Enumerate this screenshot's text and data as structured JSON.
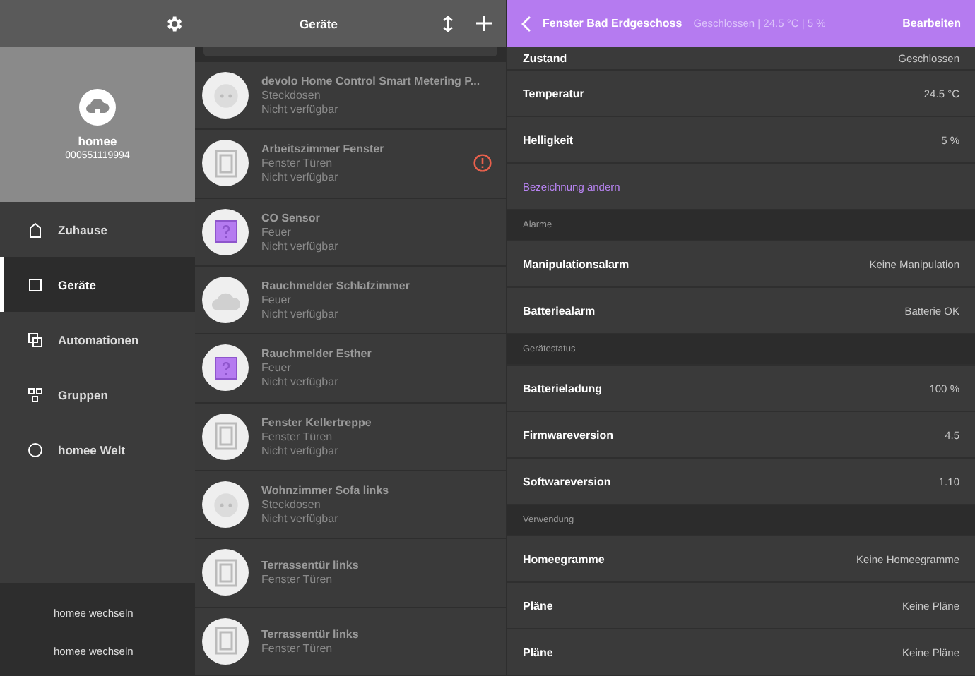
{
  "sidebar": {
    "hub": {
      "name": "homee",
      "id": "000551119994"
    },
    "items": [
      {
        "label": "Zuhause",
        "selected": false
      },
      {
        "label": "Geräte",
        "selected": true
      },
      {
        "label": "Automationen",
        "selected": false
      },
      {
        "label": "Gruppen",
        "selected": false
      },
      {
        "label": "homee Welt",
        "selected": false
      }
    ],
    "footer": [
      "homee wechseln",
      "homee wechseln"
    ]
  },
  "device_list": {
    "title": "Geräte",
    "devices": [
      {
        "name": "devolo Home Control Smart Metering P...",
        "category": "Steckdosen",
        "status": "Nicht verfügbar",
        "kind": "socket",
        "warning": false
      },
      {
        "name": "Arbeitszimmer Fenster",
        "category": "Fenster Türen",
        "status": "Nicht verfügbar",
        "kind": "window",
        "warning": true
      },
      {
        "name": "CO Sensor",
        "category": "Feuer",
        "status": "Nicht verfügbar",
        "kind": "unknown",
        "warning": false
      },
      {
        "name": "Rauchmelder Schlafzimmer",
        "category": "Feuer",
        "status": "Nicht verfügbar",
        "kind": "cloud",
        "warning": false
      },
      {
        "name": "Rauchmelder Esther",
        "category": "Feuer",
        "status": "Nicht verfügbar",
        "kind": "unknown",
        "warning": false
      },
      {
        "name": "Fenster Kellertreppe",
        "category": "Fenster Türen",
        "status": "Nicht verfügbar",
        "kind": "window",
        "warning": false
      },
      {
        "name": "Wohnzimmer Sofa links",
        "category": "Steckdosen",
        "status": "Nicht verfügbar",
        "kind": "socket",
        "warning": false
      },
      {
        "name": "Terrassentür links",
        "category": "Fenster Türen",
        "kind": "window",
        "warning": false
      },
      {
        "name": "Terrassentür links",
        "category": "Fenster Türen",
        "kind": "window",
        "warning": false
      }
    ]
  },
  "detail": {
    "title": "Fenster Bad Erdgeschoss",
    "subtitle": "Geschlossen | 24.5 °C | 5 %",
    "action": "Bearbeiten",
    "rows": [
      {
        "kind": "value",
        "label": "Zustand",
        "value": "Geschlossen"
      },
      {
        "kind": "value",
        "label": "Temperatur",
        "value": "24.5 °C"
      },
      {
        "kind": "value",
        "label": "Helligkeit",
        "value": "5 %"
      },
      {
        "kind": "link",
        "label": "Bezeichnung ändern"
      },
      {
        "kind": "section",
        "label": "Alarme"
      },
      {
        "kind": "value",
        "label": "Manipulationsalarm",
        "value": "Keine Manipulation"
      },
      {
        "kind": "value",
        "label": "Batteriealarm",
        "value": "Batterie OK"
      },
      {
        "kind": "section",
        "label": "Gerätestatus"
      },
      {
        "kind": "value",
        "label": "Batterieladung",
        "value": "100 %"
      },
      {
        "kind": "value",
        "label": "Firmwareversion",
        "value": "4.5"
      },
      {
        "kind": "value",
        "label": "Softwareversion",
        "value": "1.10"
      },
      {
        "kind": "section",
        "label": "Verwendung"
      },
      {
        "kind": "value",
        "label": "Homeegramme",
        "value": "Keine Homeegramme"
      },
      {
        "kind": "value",
        "label": "Pläne",
        "value": "Keine Pläne"
      },
      {
        "kind": "value",
        "label": "Pläne",
        "value": "Keine Pläne"
      }
    ]
  }
}
